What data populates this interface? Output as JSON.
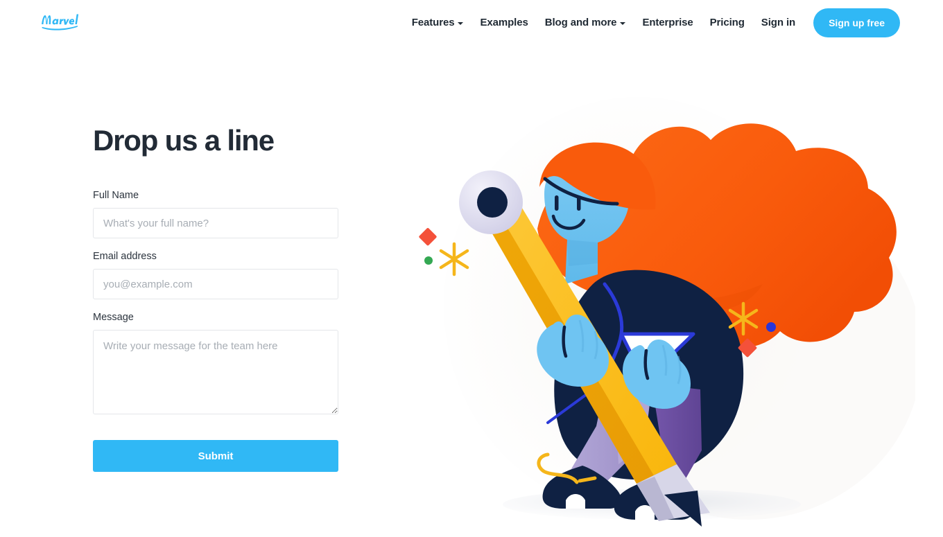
{
  "brand": {
    "logo_text": "Marvel",
    "logo_color": "#30b8f5"
  },
  "header": {
    "nav_items": [
      {
        "label": "Features",
        "has_caret": true
      },
      {
        "label": "Examples",
        "has_caret": false
      },
      {
        "label": "Blog and more",
        "has_caret": true
      },
      {
        "label": "Enterprise",
        "has_caret": false
      },
      {
        "label": "Pricing",
        "has_caret": false
      },
      {
        "label": "Sign in",
        "has_caret": false
      }
    ],
    "signup_label": "Sign up free",
    "signup_color": "#30b8f5"
  },
  "main": {
    "title": "Drop us a line",
    "fields": {
      "full_name": {
        "label": "Full Name",
        "placeholder": "What's your full name?",
        "value": ""
      },
      "email": {
        "label": "Email address",
        "placeholder": "you@example.com",
        "value": ""
      },
      "message": {
        "label": "Message",
        "placeholder": "Write your message for the team here",
        "value": ""
      }
    },
    "submit_label": "Submit",
    "submit_color": "#30b8f5"
  },
  "illustration": {
    "alt": "Person carrying a large yellow pencil",
    "colors": {
      "hair_orange": "#f95b0c",
      "skin_blue": "#6fc4f2",
      "jacket_navy": "#0f2143",
      "pencil_yellow": "#fcb814",
      "pencil_wood": "#d7d6e8",
      "trouser_light": "#a89cd0",
      "trouser_dark": "#6b4f9e",
      "eraser_lavender": "#dcdaf0",
      "accent_red": "#f4513a",
      "accent_green": "#34a853",
      "accent_blue": "#2a35d8",
      "accent_star": "#f5b61b",
      "ground_gray": "#eceef2"
    }
  }
}
